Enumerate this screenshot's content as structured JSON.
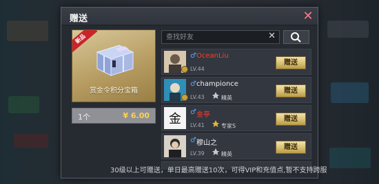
{
  "dialog": {
    "title": "赠送",
    "close_icon": "close-icon"
  },
  "item": {
    "corner_badge": "新品",
    "name": "赏金令积分宝箱",
    "quantity": "1个",
    "price": "¥ 6.00"
  },
  "search": {
    "placeholder": "查找好友",
    "value": "",
    "clear_icon": "clear-icon",
    "search_icon": "search-icon"
  },
  "friends": [
    {
      "gender": "♂",
      "name": "OceanLiu",
      "level": "LV.44",
      "rank": "",
      "gift_label": "赠送",
      "name_color": "#ff3b30"
    },
    {
      "gender": "♂",
      "name": "championce",
      "level": "LV.43",
      "rank": "精英",
      "gift_label": "赠送",
      "name_color": "#f0f0f0"
    },
    {
      "gender": "♂",
      "name": "金亭",
      "level": "LV.41",
      "rank": "专家S",
      "gift_label": "赠送",
      "name_color": "#ff3b30"
    },
    {
      "gender": "♂",
      "name": "穆山之",
      "level": "LV.39",
      "rank": "精英",
      "gift_label": "赠送",
      "name_color": "#f0f0f0"
    }
  ],
  "footer_note": "30级以上可赠送，单日最高赠送10次，可得VIP和充值点,暂不支持跨服",
  "colors": {
    "accent_gold": "#d7bf73",
    "price_yellow": "#ffd24a",
    "name_red": "#ff3b30",
    "gender_blue": "#5aa8ff"
  }
}
